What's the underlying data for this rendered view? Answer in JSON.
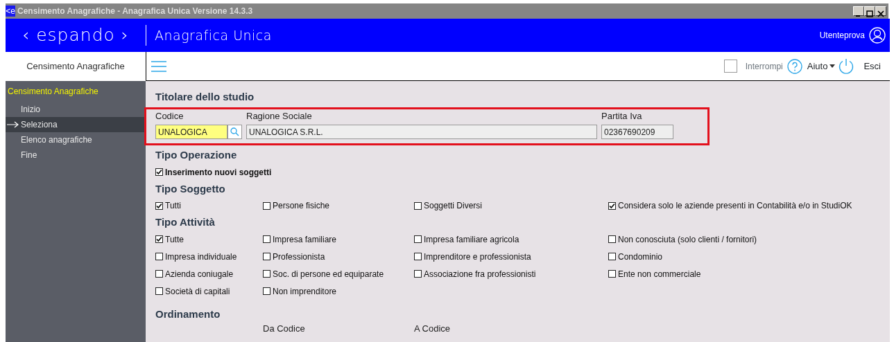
{
  "window": {
    "title": "Censimento Anagrafiche - Anagrafica Unica Versione 14.3.3",
    "app_icon": "<e"
  },
  "header": {
    "logo": "‹ espando ›",
    "app_title": "Anagrafica Unica",
    "user": "Utenteprova"
  },
  "toolbar": {
    "stop": {
      "label": "Interrompi",
      "checked": false
    },
    "help": "Aiuto",
    "exit": "Esci"
  },
  "sidebar": {
    "heading": "Censimento Anagrafiche",
    "section": "Censimento Anagrafiche",
    "items": [
      {
        "label": "Inizio",
        "selected": false
      },
      {
        "label": "Seleziona",
        "selected": true
      },
      {
        "label": "Elenco anagrafiche",
        "selected": false
      },
      {
        "label": "Fine",
        "selected": false
      }
    ]
  },
  "titolare": {
    "title": "Titolare dello studio",
    "fields": [
      {
        "kind": "lookup",
        "label": "Codice",
        "value": "UNALOGICA"
      },
      {
        "kind": "text",
        "label": "Ragione Sociale",
        "value": "UNALOGICA S.R.L."
      },
      {
        "kind": "short",
        "label": "Partita Iva",
        "value": "02367690209"
      }
    ]
  },
  "groups": [
    {
      "title": "Tipo Operazione",
      "bold": true,
      "options": [
        {
          "label": "Inserimento nuovi soggetti",
          "checked": true
        }
      ]
    },
    {
      "title": "Tipo Soggetto",
      "bold": false,
      "options": [
        {
          "label": "Tutti",
          "checked": true
        },
        {
          "label": "Persone fisiche",
          "checked": false
        },
        {
          "label": "Soggetti Diversi",
          "checked": false
        },
        {
          "label": "Considera solo le aziende presenti in Contabilità e/o in StudiOK",
          "checked": true
        }
      ]
    },
    {
      "title": "Tipo Attività",
      "bold": false,
      "options": [
        {
          "label": "Tutte",
          "checked": true
        },
        {
          "label": "Impresa familiare",
          "checked": false
        },
        {
          "label": "Impresa familiare agricola",
          "checked": false
        },
        {
          "label": "Non conosciuta (solo clienti / fornitori)",
          "checked": false
        },
        {
          "label": "Impresa individuale",
          "checked": false
        },
        {
          "label": "Professionista",
          "checked": false
        },
        {
          "label": "Imprenditore e professionista",
          "checked": false
        },
        {
          "label": "Condominio",
          "checked": false
        },
        {
          "label": "Azienda coniugale",
          "checked": false
        },
        {
          "label": "Soc. di persone ed equiparate",
          "checked": false
        },
        {
          "label": "Associazione fra professionisti",
          "checked": false
        },
        {
          "label": "Ente non commerciale",
          "checked": false
        },
        {
          "label": "Società di capitali",
          "checked": false
        },
        {
          "label": "Non imprenditore",
          "checked": false
        }
      ]
    }
  ],
  "ordinamento": {
    "title": "Ordinamento",
    "columns": [
      "Da Codice",
      "A Codice"
    ]
  }
}
